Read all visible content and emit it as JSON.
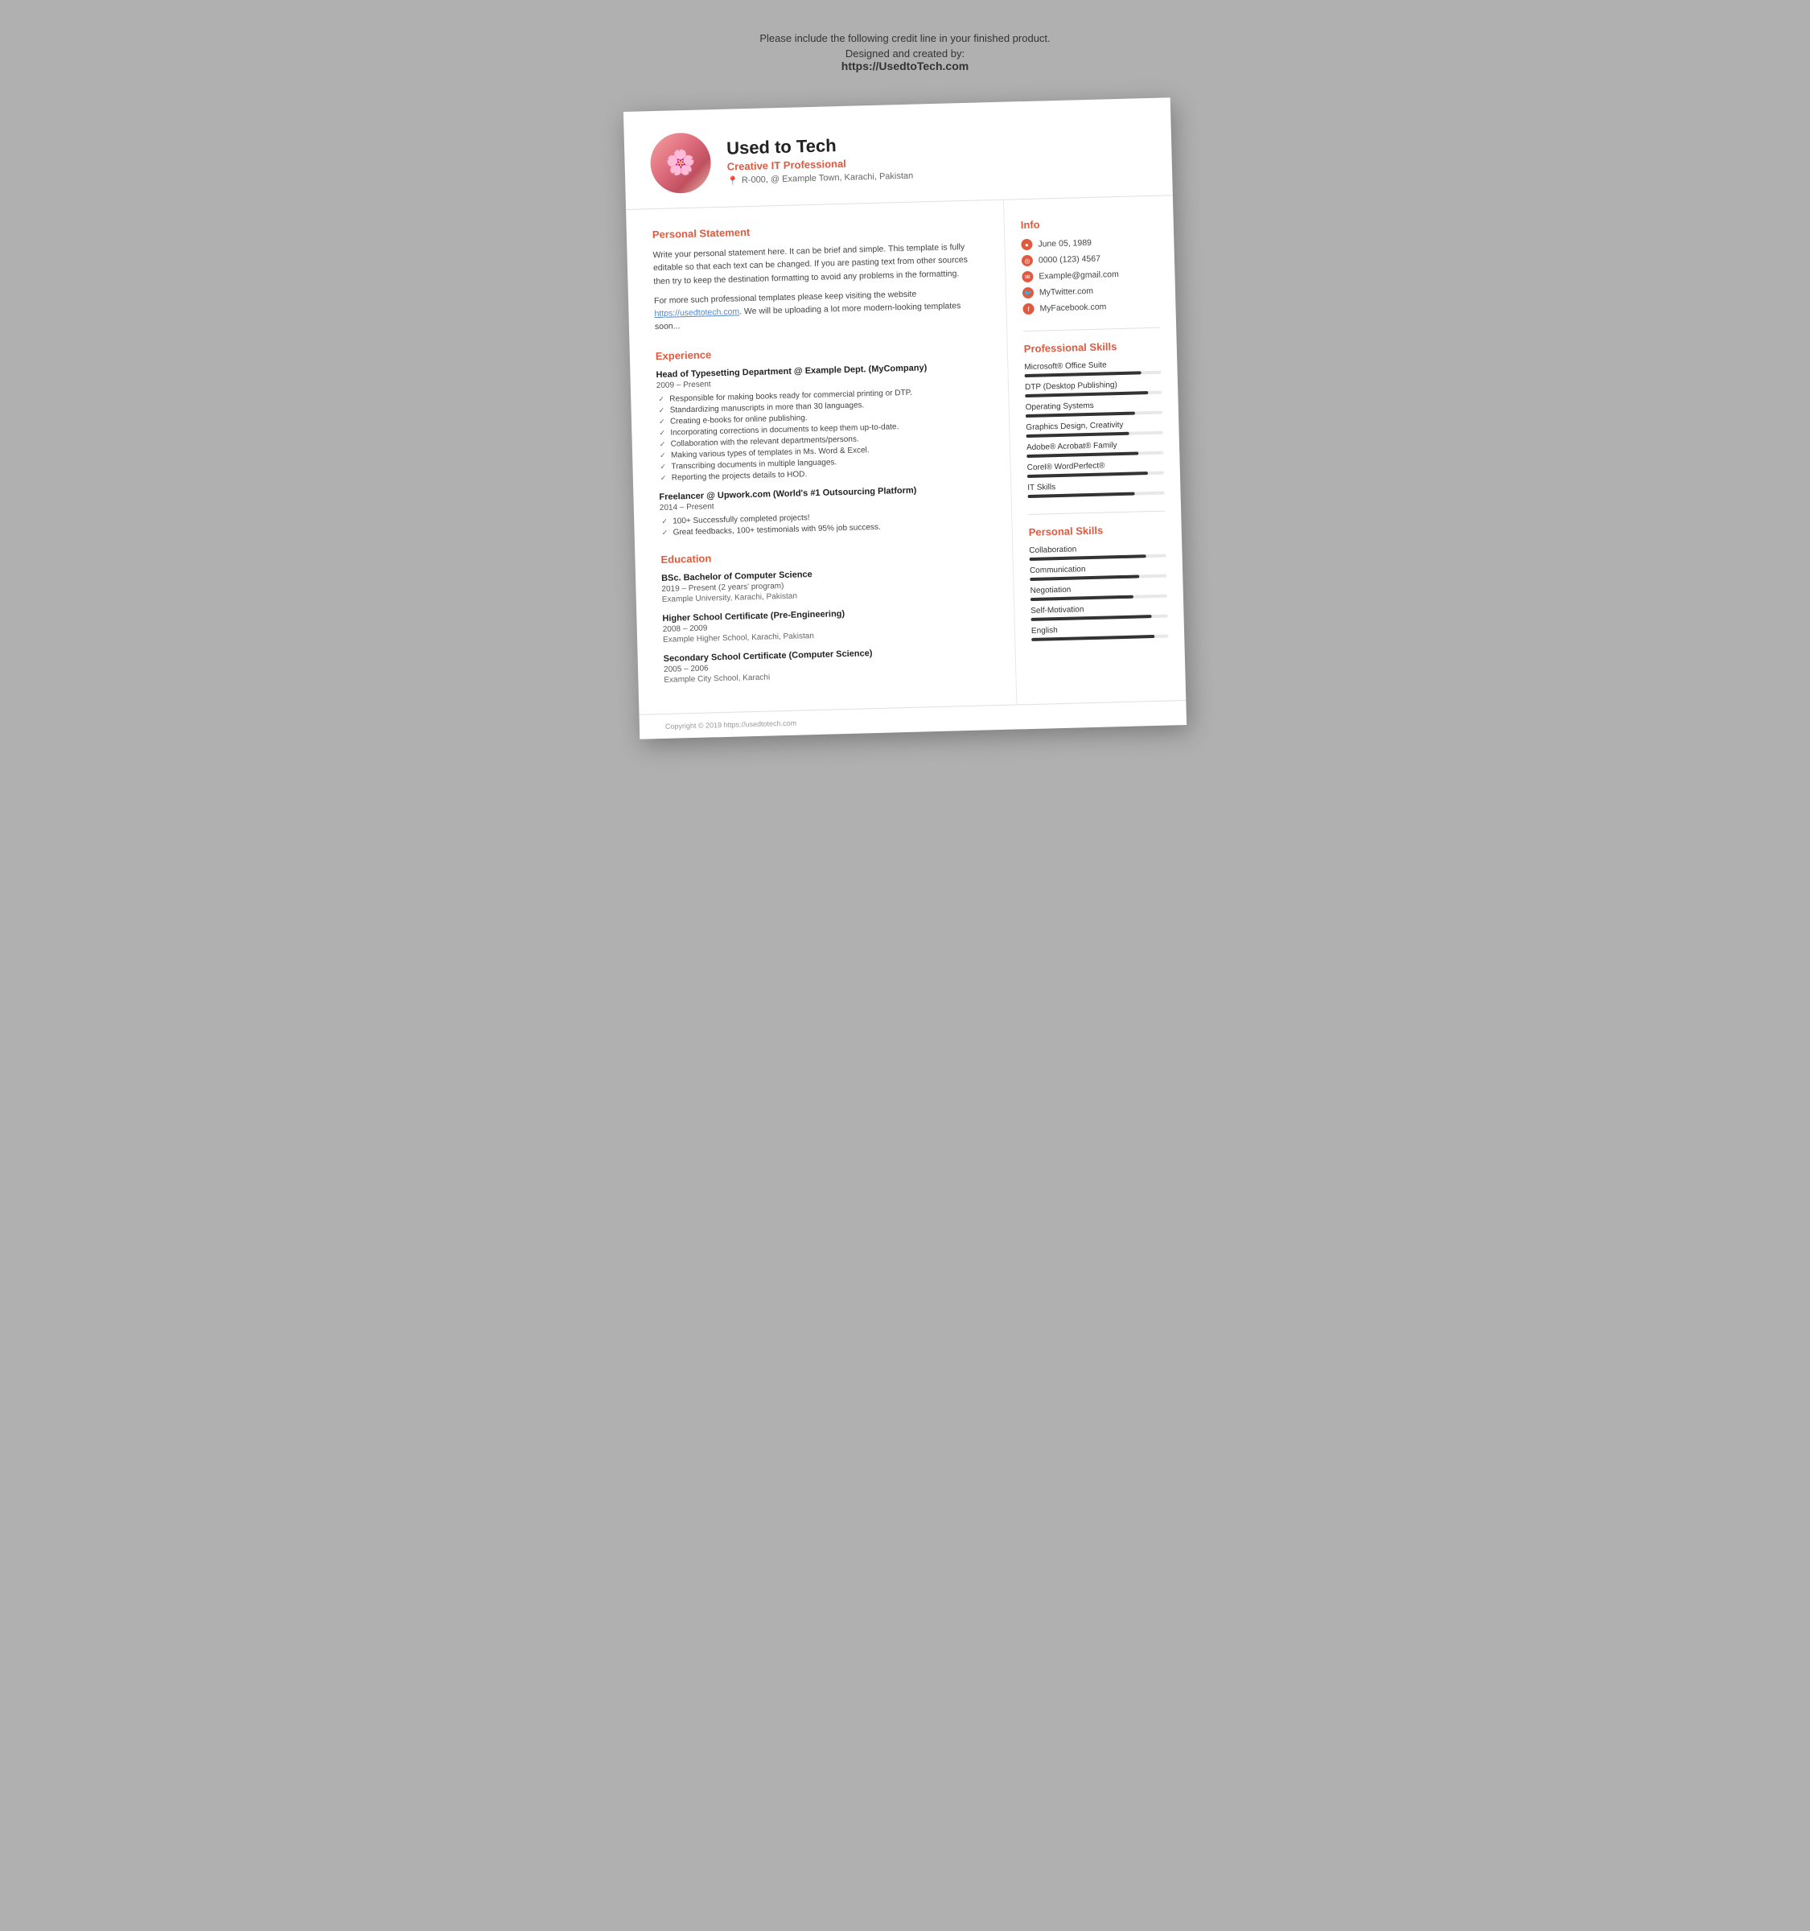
{
  "credit": {
    "line1": "Please include the following credit line in your finished product.",
    "line2": "Designed and created by:",
    "url": "https://UsedtoTech.com"
  },
  "header": {
    "name": "Used to Tech",
    "title": "Creative IT Professional",
    "address": "R-000, @ Example Town, Karachi, Pakistan",
    "avatar_emoji": "🌸"
  },
  "personal_statement": {
    "section_title": "Personal Statement",
    "para1": "Write your personal statement here. It can be brief and simple. This template is fully editable so that each text can be changed. If you are pasting text from other sources then try to keep the destination formatting to avoid any problems in the formatting.",
    "para2": "For more such professional templates please keep visiting the website https://usedtotech.com. We will be uploading a lot more modern-looking templates soon..."
  },
  "experience": {
    "section_title": "Experience",
    "jobs": [
      {
        "title": "Head of Typesetting Department @ Example Dept. (MyCompany)",
        "period": "2009 – Present",
        "duties": [
          "Responsible for making books ready for commercial printing or DTP.",
          "Standardizing manuscripts in more than 30 languages.",
          "Creating e-books for online publishing.",
          "Incorporating corrections in documents to keep them up-to-date.",
          "Collaboration with the relevant departments/persons.",
          "Making various types of templates in Ms. Word & Excel.",
          "Transcribing documents in multiple languages.",
          "Reporting the projects details to HOD."
        ]
      },
      {
        "title": "Freelancer @ Upwork.com (World's #1 Outsourcing Platform)",
        "period": "2014 – Present",
        "duties": [
          "100+ Successfully completed projects!",
          "Great feedbacks, 100+ testimonials with 95% job success."
        ]
      }
    ]
  },
  "education": {
    "section_title": "Education",
    "items": [
      {
        "title": "BSc. Bachelor of Computer Science",
        "period": "2019 – Present (2 years' program)",
        "institution": "Example University, Karachi, Pakistan"
      },
      {
        "title": "Higher School Certificate (Pre-Engineering)",
        "period": "2008 – 2009",
        "institution": "Example Higher School, Karachi, Pakistan"
      },
      {
        "title": "Secondary School Certificate (Computer Science)",
        "period": "2005 – 2006",
        "institution": "Example City School, Karachi"
      }
    ]
  },
  "info": {
    "section_title": "Info",
    "items": [
      {
        "icon": "📅",
        "type": "date",
        "value": "June 05, 1989"
      },
      {
        "icon": "📞",
        "type": "phone",
        "value": "0000 (123) 4567"
      },
      {
        "icon": "✉",
        "type": "email",
        "value": "Example@gmail.com"
      },
      {
        "icon": "🐦",
        "type": "twitter",
        "value": "MyTwitter.com"
      },
      {
        "icon": "📘",
        "type": "facebook",
        "value": "MyFacebook.com"
      }
    ]
  },
  "professional_skills": {
    "section_title": "Professional Skills",
    "items": [
      {
        "name": "Microsoft® Office Suite",
        "percent": 85
      },
      {
        "name": "DTP (Desktop Publishing)",
        "percent": 90
      },
      {
        "name": "Operating Systems",
        "percent": 80
      },
      {
        "name": "Graphics Design, Creativity",
        "percent": 75
      },
      {
        "name": "Adobe® Acrobat® Family",
        "percent": 82
      },
      {
        "name": "Corel® WordPerfect®",
        "percent": 88
      },
      {
        "name": "IT Skills",
        "percent": 78
      }
    ]
  },
  "personal_skills": {
    "section_title": "Personal Skills",
    "items": [
      {
        "name": "Collaboration",
        "percent": 85
      },
      {
        "name": "Communication",
        "percent": 80
      },
      {
        "name": "Negotiation",
        "percent": 75
      },
      {
        "name": "Self-Motivation",
        "percent": 88
      },
      {
        "name": "English",
        "percent": 90
      }
    ]
  },
  "footer": {
    "copyright": "Copyright © 2019 https://usedtotech.com"
  }
}
